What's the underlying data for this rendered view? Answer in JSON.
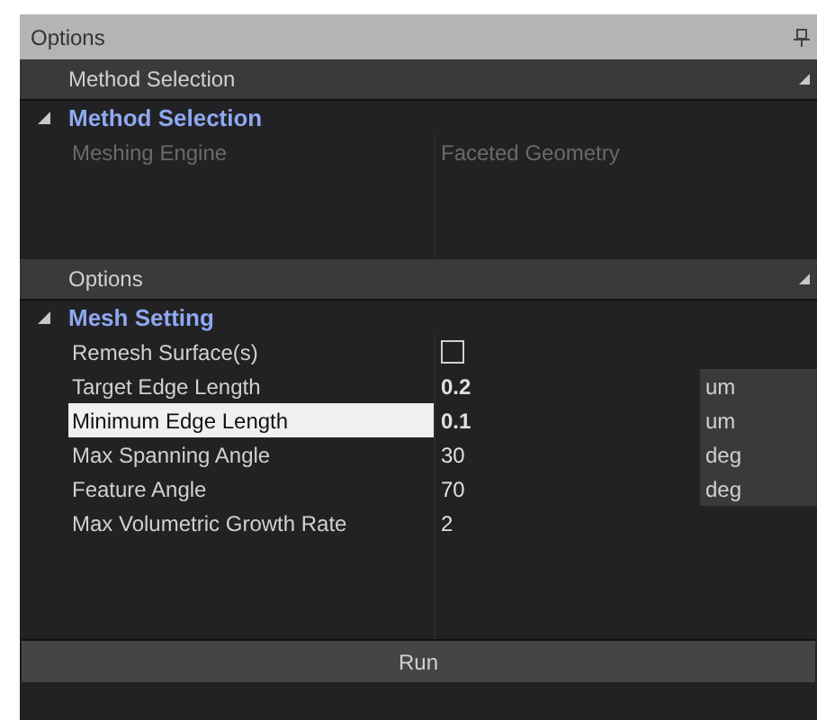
{
  "window": {
    "title": "Options"
  },
  "sections": [
    {
      "header": "Method Selection",
      "groups": [
        {
          "title": "Method Selection",
          "expanded": true,
          "rows": [
            {
              "kind": "text",
              "label": "Meshing Engine",
              "value": "Faceted Geometry",
              "disabled": true,
              "selected": false,
              "modified": false
            }
          ]
        }
      ]
    },
    {
      "header": "Options",
      "groups": [
        {
          "title": "Mesh Setting",
          "expanded": true,
          "rows": [
            {
              "kind": "checkbox",
              "label": "Remesh Surface(s)",
              "checked": false,
              "disabled": false,
              "selected": false
            },
            {
              "kind": "text",
              "label": "Target Edge Length",
              "value": "0.2",
              "unit": "um",
              "disabled": false,
              "selected": false,
              "modified": true
            },
            {
              "kind": "text",
              "label": "Minimum Edge Length",
              "value": "0.1",
              "unit": "um",
              "disabled": false,
              "selected": true,
              "modified": true
            },
            {
              "kind": "text",
              "label": "Max Spanning Angle",
              "value": "30",
              "unit": "deg",
              "disabled": false,
              "selected": false,
              "modified": false
            },
            {
              "kind": "text",
              "label": "Feature Angle",
              "value": "70",
              "unit": "deg",
              "disabled": false,
              "selected": false,
              "modified": false
            },
            {
              "kind": "text",
              "label": "Max Volumetric Growth Rate",
              "value": "2",
              "disabled": false,
              "selected": false,
              "modified": false
            }
          ]
        }
      ]
    }
  ],
  "run_button": "Run"
}
